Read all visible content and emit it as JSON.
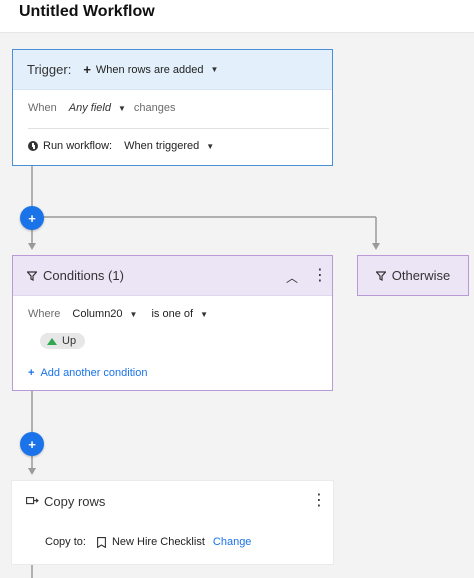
{
  "header": {
    "title": "Untitled Workflow"
  },
  "trigger": {
    "label": "Trigger:",
    "event": "When rows are added",
    "when_label": "When",
    "field": "Any field",
    "changes_label": "changes",
    "run_label": "Run workflow:",
    "run_value": "When triggered"
  },
  "conditions": {
    "title": "Conditions (1)",
    "where_label": "Where",
    "column": "Column20",
    "operator": "is one of",
    "chip": "Up",
    "add_condition": "Add another condition"
  },
  "otherwise": {
    "label": "Otherwise"
  },
  "copy": {
    "title": "Copy rows",
    "copy_to_label": "Copy to:",
    "sheet": "New Hire Checklist",
    "change": "Change"
  },
  "colors": {
    "accent": "#1a73e8",
    "trigger_border": "#4a90d9",
    "trigger_header": "#e3f0fb",
    "condition_border": "#b79ad6",
    "condition_header": "#ece5f5",
    "chip_up": "#2fa84f"
  },
  "icons": {
    "trigger_add": "plus-icon",
    "run": "clock-icon",
    "filter": "filter-icon",
    "collapse": "chevron-up-icon",
    "menu": "more-vertical-icon",
    "up": "triangle-up-icon",
    "copy": "copy-rows-icon",
    "sheet": "sheet-icon",
    "add_step": "add-step-icon"
  }
}
